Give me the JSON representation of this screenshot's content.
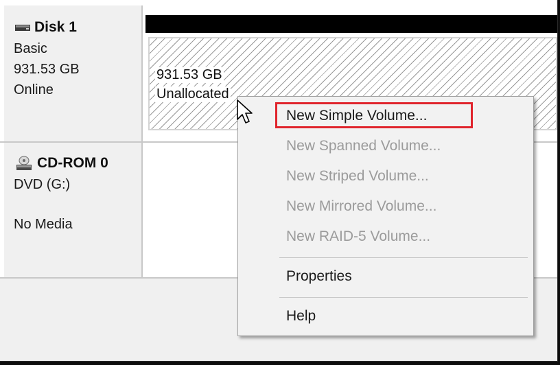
{
  "disk1": {
    "name": "Disk 1",
    "type": "Basic",
    "size": "931.53 GB",
    "status": "Online",
    "icon": "hard-disk-icon"
  },
  "partition": {
    "size": "931.53 GB",
    "state": "Unallocated"
  },
  "cdrom": {
    "name": "CD-ROM 0",
    "type": "DVD (G:)",
    "status": "No Media",
    "icon": "cd-drive-icon"
  },
  "context_menu": {
    "items": [
      {
        "label": "New Simple Volume...",
        "enabled": true,
        "highlighted": true
      },
      {
        "label": "New Spanned Volume...",
        "enabled": false
      },
      {
        "label": "New Striped Volume...",
        "enabled": false
      },
      {
        "label": "New Mirrored Volume...",
        "enabled": false
      },
      {
        "label": "New RAID-5 Volume...",
        "enabled": false
      },
      {
        "label": "Properties",
        "enabled": true
      },
      {
        "label": "Help",
        "enabled": true
      }
    ]
  },
  "colors": {
    "highlight_border": "#e0242c",
    "partition_header": "#000000",
    "disabled_text": "#9b9b9b"
  }
}
